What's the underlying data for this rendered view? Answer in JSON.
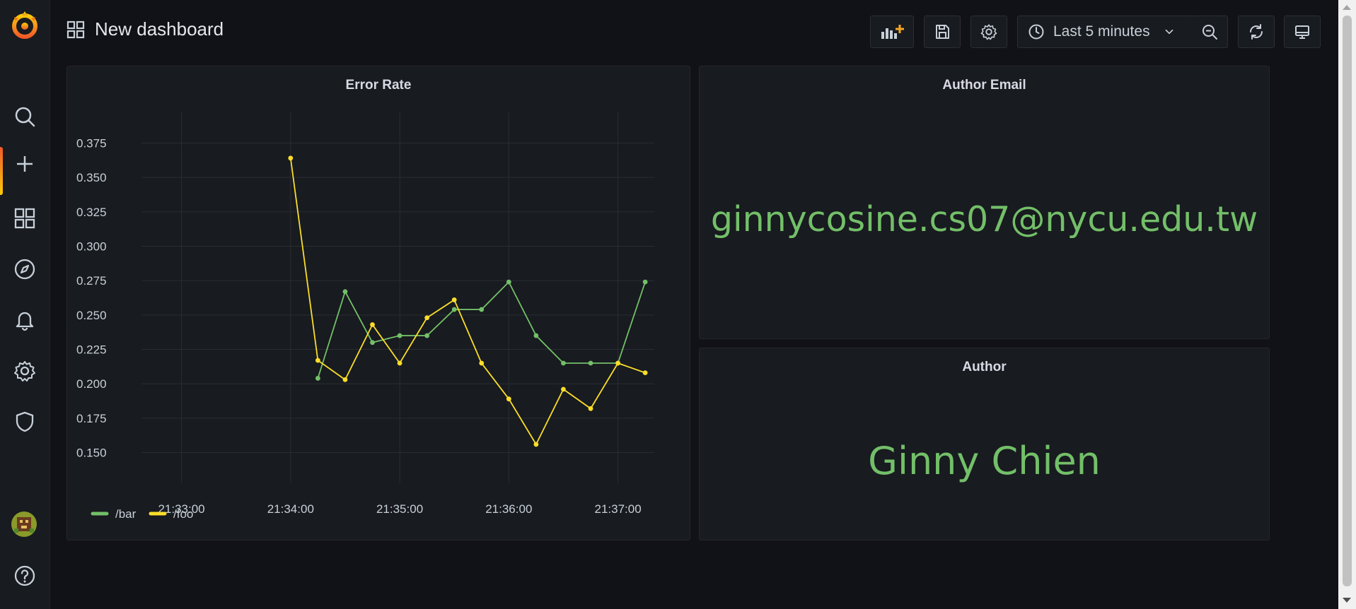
{
  "header": {
    "title": "New dashboard",
    "time_range": "Last 5 minutes"
  },
  "icons": {
    "logo": "grafana-logo-icon",
    "nav": [
      "search-icon",
      "plus-icon",
      "dashboards-grid-icon",
      "compass-icon",
      "bell-icon",
      "gear-icon",
      "shield-icon"
    ],
    "toolbar": [
      "add-panel-icon",
      "save-icon",
      "gear-icon",
      "clock-icon",
      "chevron-down-icon",
      "zoom-out-icon",
      "refresh-icon",
      "tv-mode-icon"
    ],
    "bottom": [
      "avatar",
      "help-icon"
    ]
  },
  "colors": {
    "background": "#111217",
    "panel": "#181b1f",
    "green": "#73bf69",
    "yellow": "#fade2a",
    "accent": "#f05a28"
  },
  "panels": {
    "error_rate": {
      "title": "Error Rate"
    },
    "author_email": {
      "title": "Author Email",
      "value": "ginnycosine.cs07@nycu.edu.tw"
    },
    "author": {
      "title": "Author",
      "value": "Ginny Chien"
    }
  },
  "chart_data": {
    "type": "line",
    "title": "Error Rate",
    "x_tick_labels": [
      "21:33:00",
      "21:34:00",
      "21:35:00",
      "21:36:00",
      "21:37:00"
    ],
    "y_tick_labels": [
      "0.150",
      "0.175",
      "0.200",
      "0.225",
      "0.250",
      "0.275",
      "0.300",
      "0.325",
      "0.350",
      "0.375"
    ],
    "xlim": [
      "21:32:38",
      "21:37:20"
    ],
    "ylim": [
      0.138,
      0.387
    ],
    "grid": true,
    "legend_position": "bottom-left",
    "series": [
      {
        "name": "/bar",
        "color": "#73bf69",
        "x": [
          "21:34:15",
          "21:34:30",
          "21:34:45",
          "21:35:00",
          "21:35:15",
          "21:35:30",
          "21:35:45",
          "21:36:00",
          "21:36:15",
          "21:36:30",
          "21:36:45",
          "21:37:00",
          "21:37:15"
        ],
        "y": [
          0.204,
          0.267,
          0.23,
          0.235,
          0.235,
          0.254,
          0.254,
          0.274,
          0.235,
          0.215,
          0.215,
          0.215,
          0.274
        ]
      },
      {
        "name": "/foo",
        "color": "#fade2a",
        "x": [
          "21:34:00",
          "21:34:15",
          "21:34:30",
          "21:34:45",
          "21:35:00",
          "21:35:15",
          "21:35:30",
          "21:35:45",
          "21:36:00",
          "21:36:15",
          "21:36:30",
          "21:36:45",
          "21:37:00",
          "21:37:15"
        ],
        "y": [
          0.364,
          0.217,
          0.203,
          0.243,
          0.215,
          0.248,
          0.261,
          0.215,
          0.189,
          0.156,
          0.196,
          0.182,
          0.215,
          0.208
        ]
      }
    ]
  }
}
